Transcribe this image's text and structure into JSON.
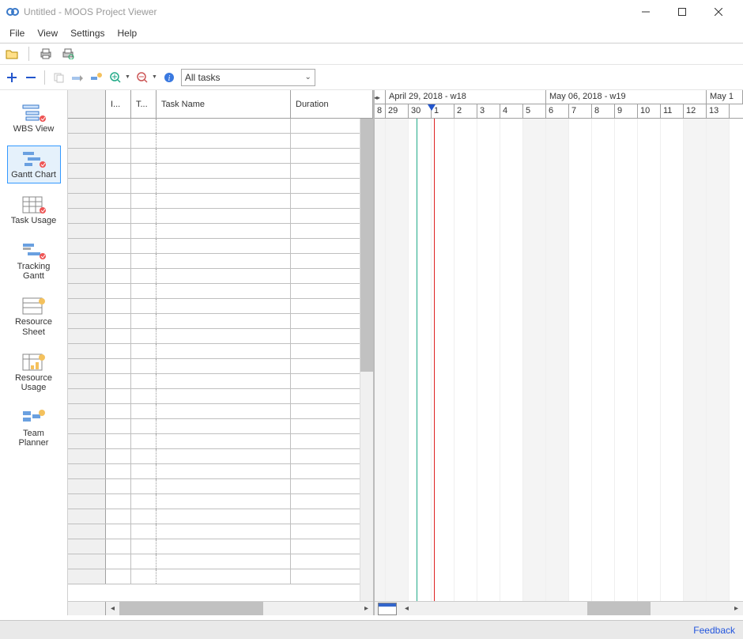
{
  "window": {
    "title": "Untitled - MOOS Project Viewer"
  },
  "menu": {
    "file": "File",
    "view": "View",
    "settings": "Settings",
    "help": "Help"
  },
  "toolbar2": {
    "filter_value": "All tasks"
  },
  "views": [
    {
      "label": "WBS View"
    },
    {
      "label": "Gantt Chart"
    },
    {
      "label": "Task Usage"
    },
    {
      "label": "Tracking Gantt"
    },
    {
      "label": "Resource Sheet"
    },
    {
      "label": "Resource Usage"
    },
    {
      "label": "Team Planner"
    }
  ],
  "grid": {
    "columns": {
      "indicator": "I...",
      "taskmode": "T...",
      "name": "Task Name",
      "duration": "Duration"
    }
  },
  "timeline": {
    "weeks": [
      {
        "label": "April 29, 2018 - w18"
      },
      {
        "label": "May 06, 2018 - w19"
      },
      {
        "label": "May 1"
      }
    ],
    "days": [
      "8",
      "29",
      "30",
      "1",
      "2",
      "3",
      "4",
      "5",
      "6",
      "7",
      "8",
      "9",
      "10",
      "11",
      "12",
      "13"
    ]
  },
  "status": {
    "feedback": "Feedback"
  }
}
